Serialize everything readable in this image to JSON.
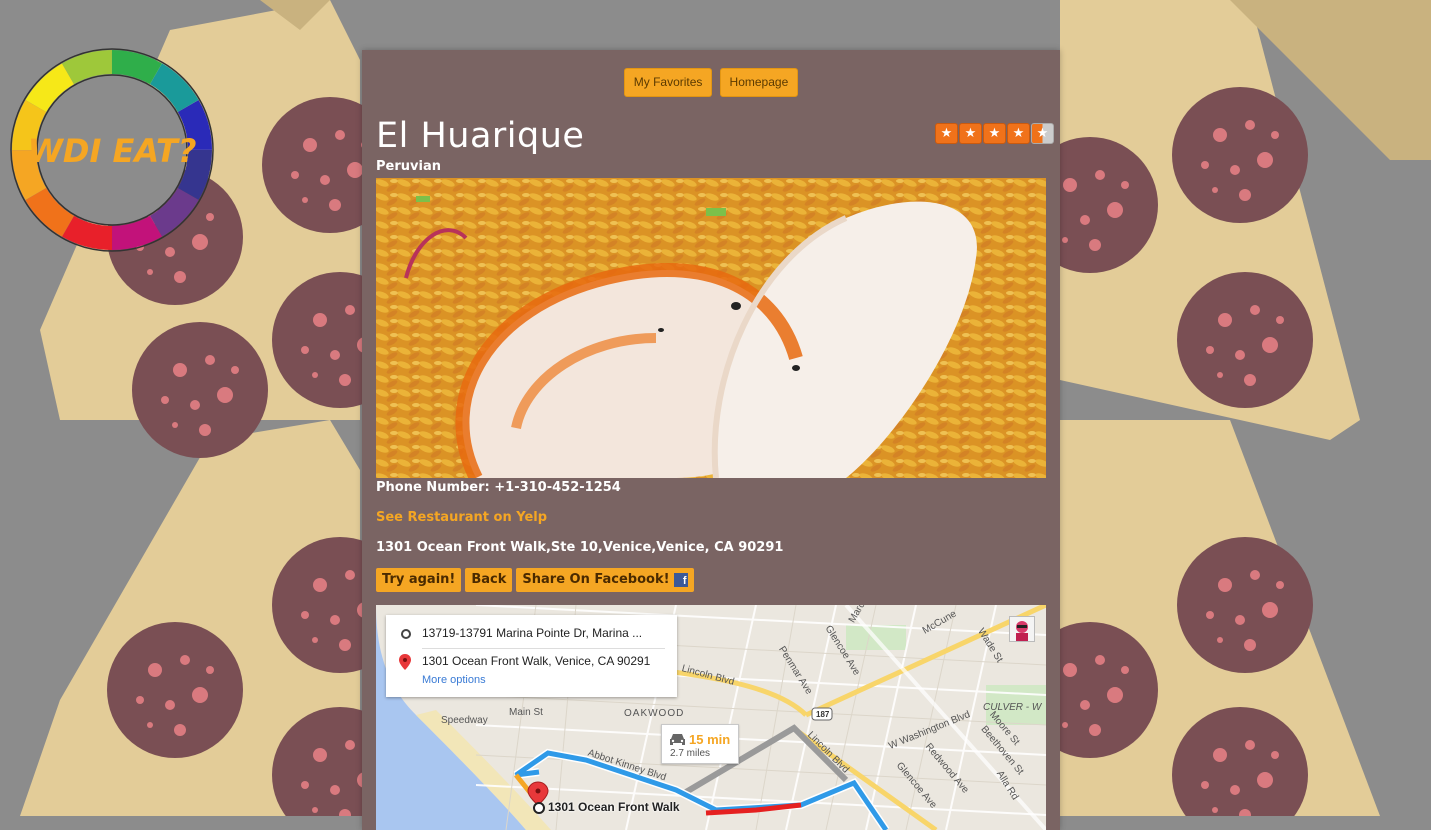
{
  "nav": {
    "favorites_label": "My Favorites",
    "homepage_label": "Homepage"
  },
  "logo": {
    "text": "WDI EAT?"
  },
  "restaurant": {
    "name": "El Huarique",
    "cuisine": "Peruvian",
    "rating": 4.5,
    "rating_max": 5,
    "phone_label": "Phone Number: +1-310-452-1254",
    "yelp_link": "See Restaurant on Yelp",
    "address": "1301 Ocean Front Walk,Ste 10,Venice,Venice, CA 90291"
  },
  "actions": {
    "try_again": "Try again!",
    "back": "Back",
    "share": "Share On Facebook!"
  },
  "map": {
    "from": "13719-13791 Marina Pointe Dr, Marina ...",
    "to": "1301 Ocean Front Walk, Venice, CA 90291",
    "more_options": "More options",
    "time": "15 min",
    "distance": "2.7 miles",
    "dest_label": "1301 Ocean Front Walk",
    "labels": {
      "oakwood": "OAKWOOD",
      "lincoln1": "Lincoln Blvd",
      "lincoln2": "Lincoln Blvd",
      "abbot": "Abbot Kinney Blvd",
      "speedway": "Speedway",
      "main": "Main St",
      "penmar": "Penmar Ave",
      "glencoe1": "Glencoe Ave",
      "glencoe2": "Glencoe Ave",
      "mccune": "McCune",
      "wade": "Wade St",
      "culver": "CULVER - W",
      "wwash": "W Washington Blvd",
      "moore": "Moore St",
      "beethoven": "Beethoven St",
      "redwood": "Redwood Ave",
      "alla": "Alla Rd",
      "marc": "Marc",
      "hwy": "187"
    }
  },
  "colors": {
    "accent": "#f5a623",
    "panel": "#7a6463",
    "background": "#8c8c8c",
    "star": "#f0721a"
  }
}
